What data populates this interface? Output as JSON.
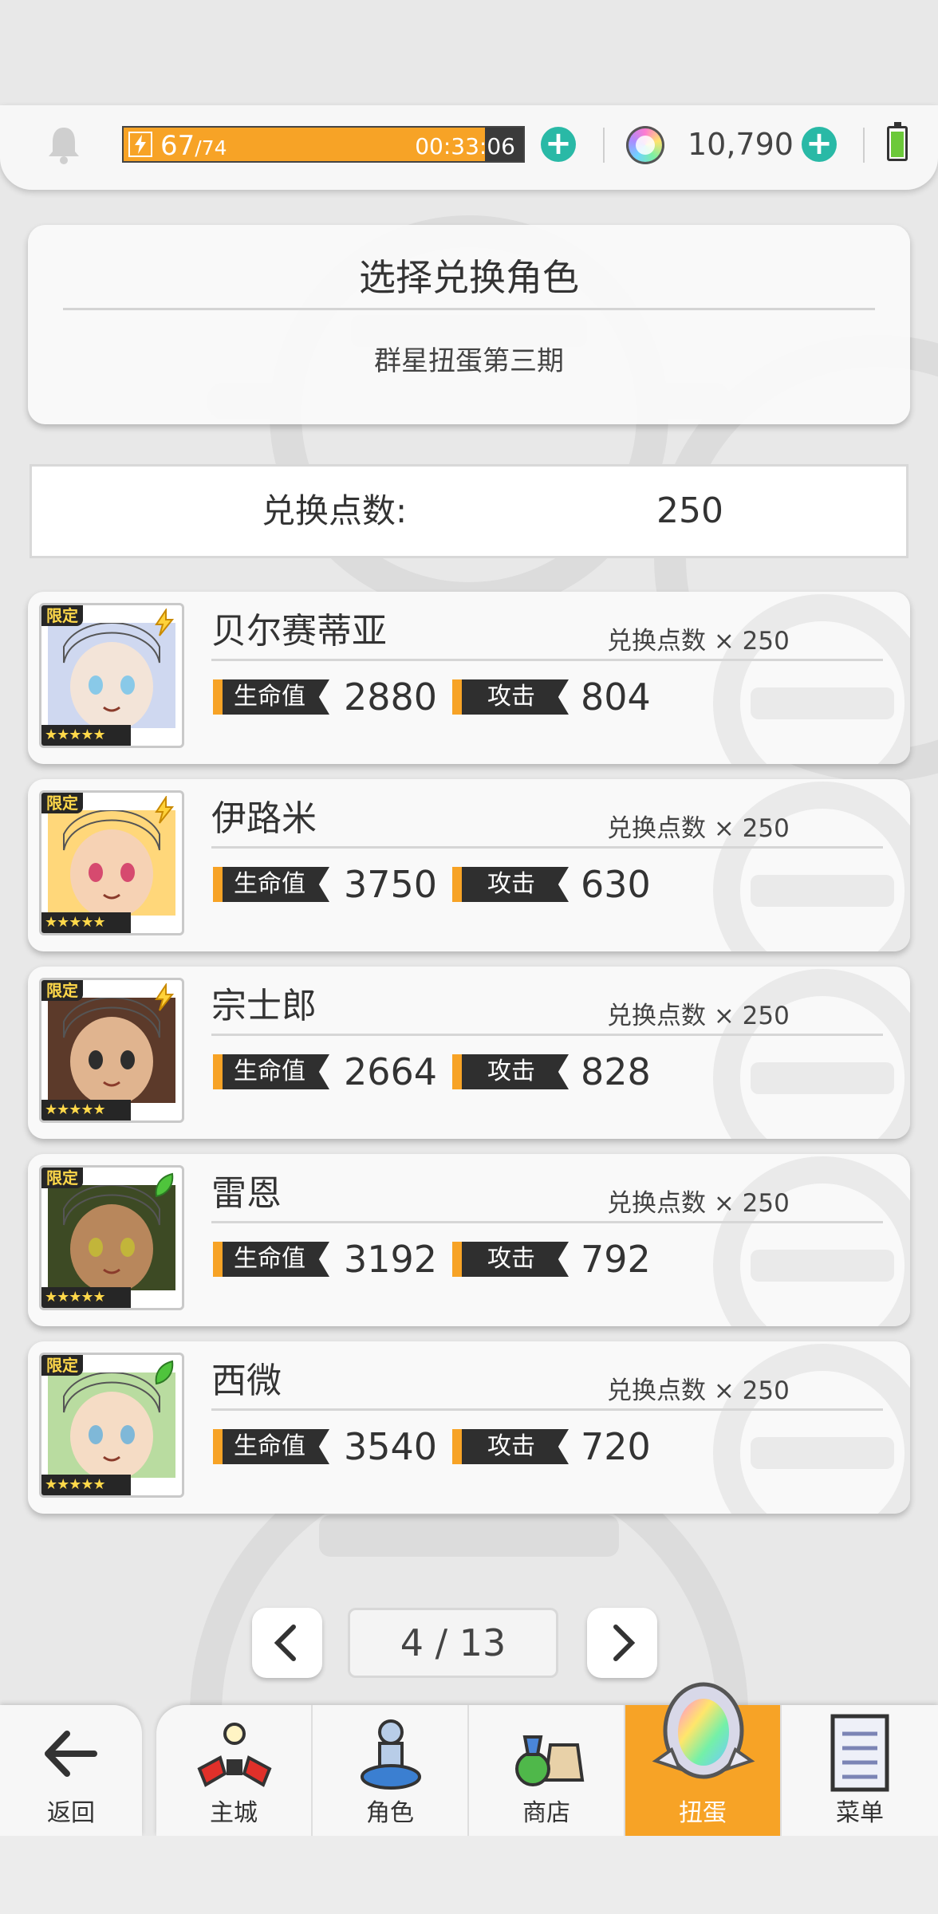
{
  "status_bar": {
    "stamina_current": "67",
    "stamina_max": "/74",
    "stamina_timer": "00:33:06",
    "stamina_fraction": 0.905,
    "gem_count": "10,790"
  },
  "header": {
    "title": "选择兑换角色",
    "subtitle": "群星扭蛋第三期"
  },
  "points": {
    "label": "兑换点数:",
    "value": "250"
  },
  "characters": [
    {
      "name": "贝尔赛蒂亚",
      "cost": "兑换点数 × 250",
      "hp_label": "生命值",
      "hp": "2880",
      "atk_label": "攻击",
      "atk": "804",
      "limited": "限定",
      "stars": "★★★★★",
      "element": "lightning-icon"
    },
    {
      "name": "伊路米",
      "cost": "兑换点数 × 250",
      "hp_label": "生命值",
      "hp": "3750",
      "atk_label": "攻击",
      "atk": "630",
      "limited": "限定",
      "stars": "★★★★★",
      "element": "lightning-icon"
    },
    {
      "name": "宗士郎",
      "cost": "兑换点数 × 250",
      "hp_label": "生命值",
      "hp": "2664",
      "atk_label": "攻击",
      "atk": "828",
      "limited": "限定",
      "stars": "★★★★★",
      "element": "lightning-icon"
    },
    {
      "name": "雷恩",
      "cost": "兑换点数 × 250",
      "hp_label": "生命值",
      "hp": "3192",
      "atk_label": "攻击",
      "atk": "792",
      "limited": "限定",
      "stars": "★★★★★",
      "element": "leaf-icon"
    },
    {
      "name": "西微",
      "cost": "兑换点数 × 250",
      "hp_label": "生命值",
      "hp": "3540",
      "atk_label": "攻击",
      "atk": "720",
      "limited": "限定",
      "stars": "★★★★★",
      "element": "leaf-icon"
    }
  ],
  "pagination": {
    "page": "4 / 13"
  },
  "nav": {
    "back": "返回",
    "items": [
      "主城",
      "角色",
      "商店",
      "扭蛋",
      "菜单"
    ],
    "active": "扭蛋"
  },
  "colors": {
    "accent": "#f7a326",
    "plus": "#29b9a6",
    "tag": "#2f2f2f"
  }
}
